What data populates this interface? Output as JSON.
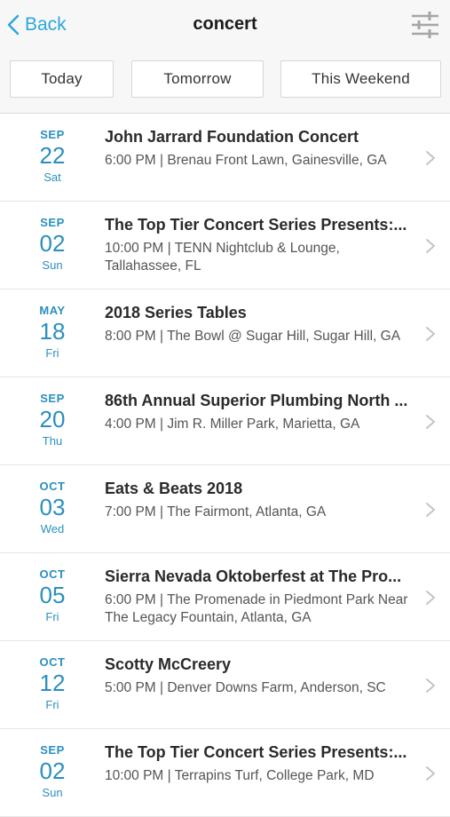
{
  "header": {
    "back_label": "Back",
    "title": "concert"
  },
  "filters": [
    {
      "label": "Today"
    },
    {
      "label": "Tomorrow"
    },
    {
      "label": "This Weekend"
    }
  ],
  "colors": {
    "accent": "#29a8dc",
    "date_text": "#2a8fbf"
  },
  "events": [
    {
      "month": "SEP",
      "day": "22",
      "weekday": "Sat",
      "name": "John Jarrard Foundation Concert",
      "details": "6:00 PM | Brenau Front Lawn, Gainesville, GA"
    },
    {
      "month": "SEP",
      "day": "02",
      "weekday": "Sun",
      "name": "The Top Tier Concert Series Presents:...",
      "details": "10:00 PM | TENN Nightclub & Lounge, Tallahassee, FL"
    },
    {
      "month": "MAY",
      "day": "18",
      "weekday": "Fri",
      "name": "2018 Series Tables",
      "details": "8:00 PM | The Bowl @ Sugar Hill, Sugar Hill, GA"
    },
    {
      "month": "SEP",
      "day": "20",
      "weekday": "Thu",
      "name": "86th Annual Superior Plumbing North ...",
      "details": "4:00 PM | Jim R. Miller Park, Marietta, GA"
    },
    {
      "month": "OCT",
      "day": "03",
      "weekday": "Wed",
      "name": "Eats & Beats 2018",
      "details": "7:00 PM | The Fairmont, Atlanta, GA"
    },
    {
      "month": "OCT",
      "day": "05",
      "weekday": "Fri",
      "name": "Sierra Nevada Oktoberfest at The Pro...",
      "details": "6:00 PM | The Promenade in Piedmont Park Near The Legacy Fountain, Atlanta, GA"
    },
    {
      "month": "OCT",
      "day": "12",
      "weekday": "Fri",
      "name": "Scotty McCreery",
      "details": "5:00 PM | Denver Downs Farm, Anderson, SC"
    },
    {
      "month": "SEP",
      "day": "02",
      "weekday": "Sun",
      "name": "The Top Tier Concert Series Presents:...",
      "details": "10:00 PM | Terrapins Turf, College Park, MD"
    }
  ]
}
